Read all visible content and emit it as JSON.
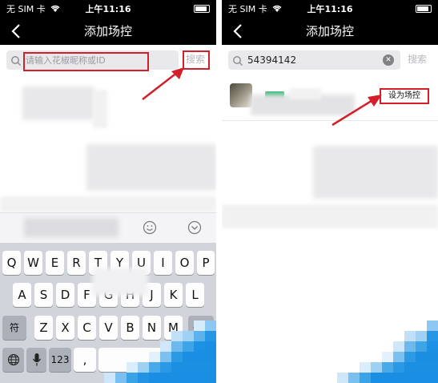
{
  "left_phone": {
    "status": {
      "carrier": "无 SIM 卡",
      "time": "上午11:16"
    },
    "nav": {
      "title": "添加场控"
    },
    "search": {
      "placeholder": "请输入花椒昵称或ID",
      "button_label": "搜索"
    },
    "keyboard": {
      "row1": [
        "Q",
        "W",
        "E",
        "R",
        "T",
        "Y",
        "U",
        "I",
        "O",
        "P"
      ],
      "row2": [
        "A",
        "S",
        "D",
        "F",
        "G",
        "H",
        "J",
        "K",
        "L"
      ],
      "row3": [
        "Z",
        "X",
        "C",
        "V",
        "B",
        "N",
        "M"
      ],
      "shift_label": "符",
      "numbers_label": "123",
      "comma_label": ","
    }
  },
  "right_phone": {
    "status": {
      "carrier": "无 SIM 卡",
      "time": "上午11:16"
    },
    "nav": {
      "title": "添加场控"
    },
    "search": {
      "value": "54394142",
      "button_label": "搜索"
    },
    "result": {
      "action_label": "设为场控"
    }
  },
  "colors": {
    "nav_bg": "#000000",
    "annotation_red": "#d41e2a",
    "keyboard_bg": "#d1d4da"
  },
  "icons": [
    "back-icon",
    "search-icon",
    "clear-icon",
    "emoji-icon",
    "chevron-down-icon",
    "globe-icon",
    "mic-icon",
    "delete-icon",
    "wifi-icon",
    "battery-icon",
    "annotation-arrow"
  ]
}
